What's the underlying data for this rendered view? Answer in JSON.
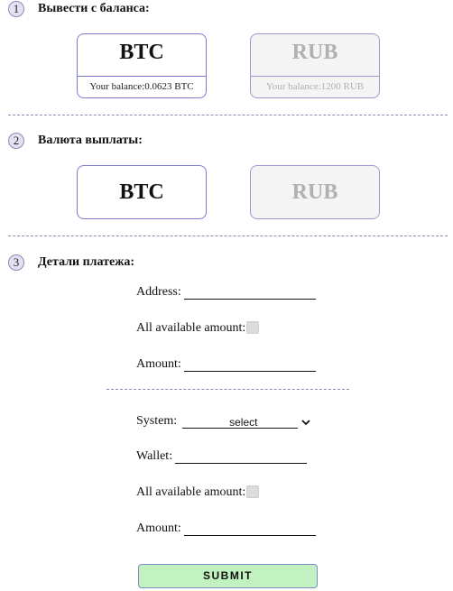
{
  "step1": {
    "num": "1",
    "title": "Вывести с баланса:"
  },
  "balances": [
    {
      "currency": "BTC",
      "balance_label": "Your balance:",
      "balance_value": "0.0623 BTC",
      "active": true
    },
    {
      "currency": "RUB",
      "balance_label": "Your balance:",
      "balance_value": "1200 RUB",
      "active": false
    }
  ],
  "step2": {
    "num": "2",
    "title": "Валюта выплаты:"
  },
  "payout": [
    {
      "currency": "BTC",
      "active": true
    },
    {
      "currency": "RUB",
      "active": false
    }
  ],
  "step3": {
    "num": "3",
    "title": "Детали платежа:"
  },
  "form1": {
    "address_label": "Address:",
    "all_amount_label": "All available amount:",
    "amount_label": "Amount:"
  },
  "form2": {
    "system_label": "System:",
    "system_selected": "select",
    "wallet_label": "Wallet:",
    "all_amount_label": "All available amount:",
    "amount_label": "Amount:"
  },
  "submit_label": "SUBMIT",
  "icons": {
    "select_arrow": "chevron-down-icon"
  }
}
